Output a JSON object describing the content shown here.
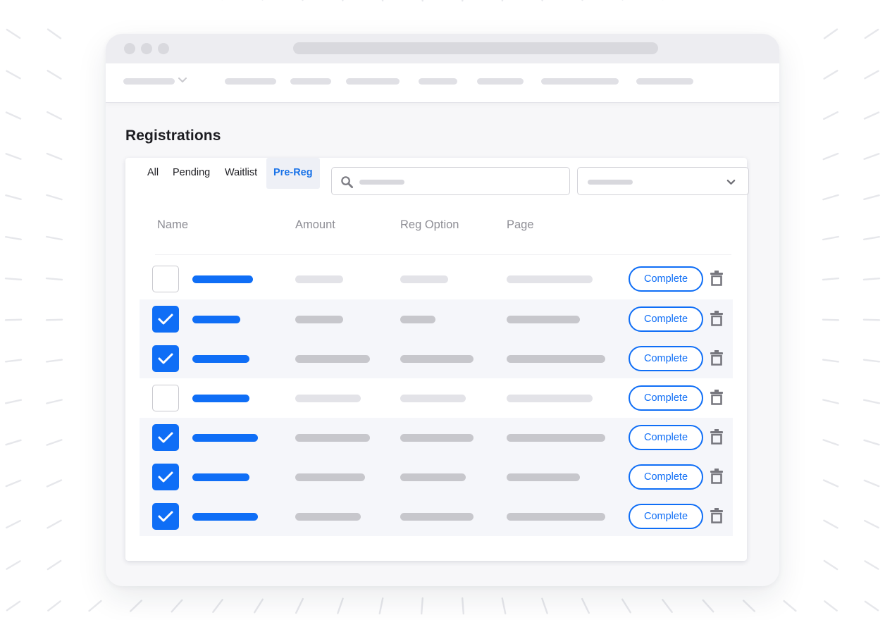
{
  "page": {
    "title": "Registrations"
  },
  "tabs": [
    {
      "label": "All",
      "active": false
    },
    {
      "label": "Pending",
      "active": false
    },
    {
      "label": "Waitlist",
      "active": false
    },
    {
      "label": "Pre-Reg",
      "active": true
    }
  ],
  "search": {
    "icon": "search-icon",
    "placeholder": ""
  },
  "filter": {
    "icon": "chevron-down-icon"
  },
  "table": {
    "columns": [
      "Name",
      "Amount",
      "Reg Option",
      "Page"
    ],
    "action_label": "Complete",
    "delete_icon": "trash-icon",
    "rows": [
      {
        "checked": false
      },
      {
        "checked": true
      },
      {
        "checked": true
      },
      {
        "checked": false
      },
      {
        "checked": true
      },
      {
        "checked": true
      },
      {
        "checked": true
      }
    ]
  },
  "colors": {
    "accent": "#0f6ef6",
    "active_tab_text": "#1a73e8",
    "selected_row_bg": "#f5f6fa",
    "placeholder_bar": "#c7c7cc",
    "window_bg": "#f7f7f9"
  }
}
